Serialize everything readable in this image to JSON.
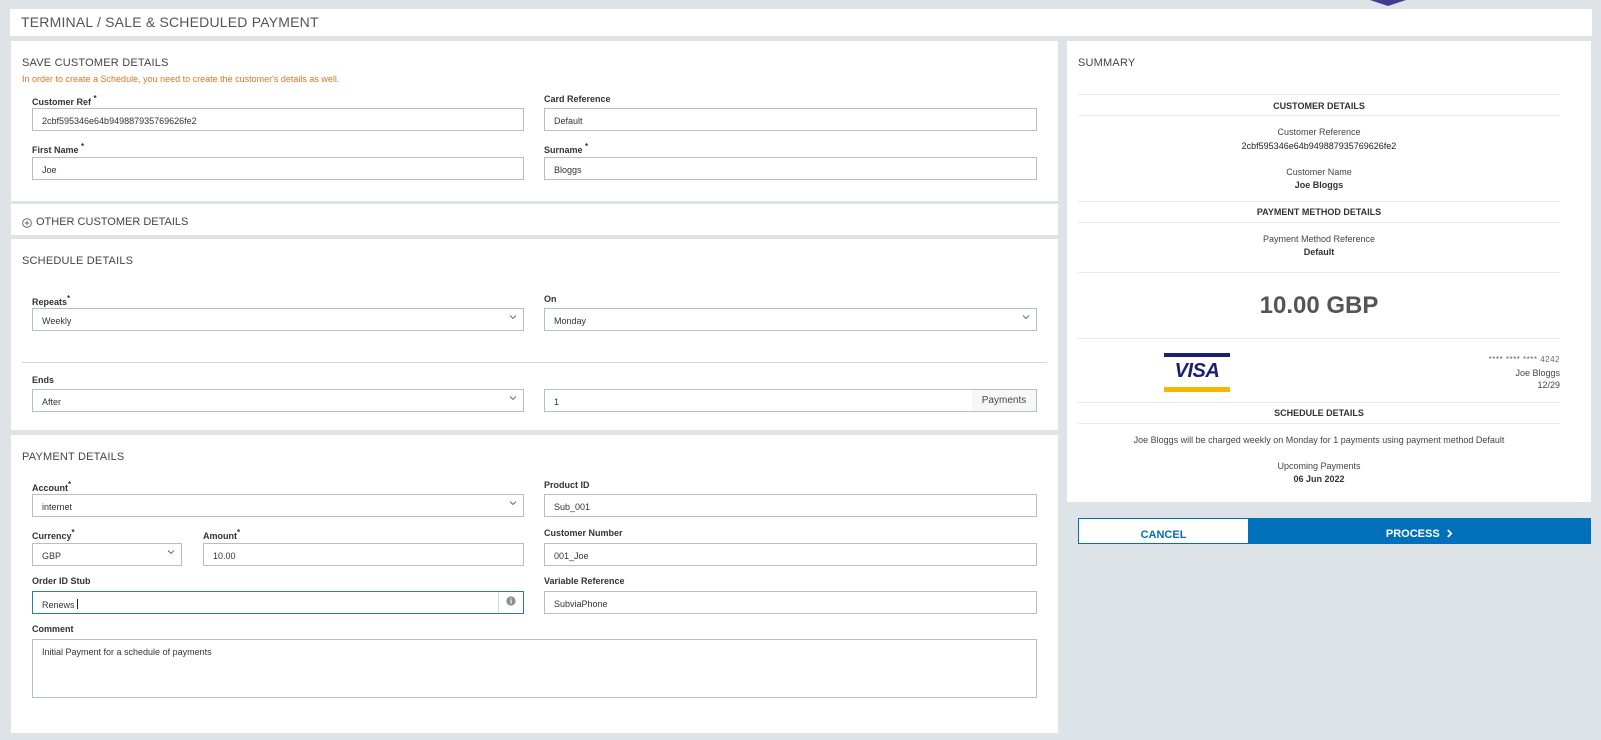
{
  "page": {
    "title": "TERMINAL / SALE & SCHEDULED PAYMENT"
  },
  "customer": {
    "section_title": "SAVE CUSTOMER DETAILS",
    "notice": "In order to create a Schedule, you need to create the customer's details as well.",
    "customer_ref_label": "Customer Ref",
    "customer_ref_value": "2cbf595346e64b949887935769626fe2",
    "card_reference_label": "Card Reference",
    "card_reference_value": "Default",
    "first_name_label": "First Name",
    "first_name_value": "Joe",
    "surname_label": "Surname",
    "surname_value": "Bloggs",
    "required_mark": "*"
  },
  "other_customer": {
    "label": "OTHER CUSTOMER DETAILS"
  },
  "schedule": {
    "section_title": "SCHEDULE DETAILS",
    "repeats_label": "Repeats",
    "repeats_value": "Weekly",
    "on_label": "On",
    "on_value": "Monday",
    "ends_label": "Ends",
    "ends_value": "After",
    "count_value": "1",
    "count_suffix": "Payments"
  },
  "payment": {
    "section_title": "PAYMENT DETAILS",
    "account_label": "Account",
    "account_value": "internet",
    "product_id_label": "Product ID",
    "product_id_value": "Sub_001",
    "currency_label": "Currency",
    "currency_value": "GBP",
    "amount_label": "Amount",
    "amount_value": "10.00",
    "customer_number_label": "Customer Number",
    "customer_number_value": "001_Joe",
    "order_id_stub_label": "Order ID Stub",
    "order_id_stub_value": "Renews",
    "variable_reference_label": "Variable Reference",
    "variable_reference_value": "SubviaPhone",
    "comment_label": "Comment",
    "comment_value": "Initial Payment for a schedule of payments"
  },
  "summary": {
    "title": "SUMMARY",
    "customer_details_heading": "CUSTOMER DETAILS",
    "customer_reference_label": "Customer Reference",
    "customer_reference_value": "2cbf595346e64b949887935769626fe2",
    "customer_name_label": "Customer Name",
    "customer_name_value": "Joe Bloggs",
    "payment_method_heading": "PAYMENT METHOD DETAILS",
    "payment_method_reference_label": "Payment Method Reference",
    "payment_method_reference_value": "Default",
    "amount_total": "10.00 GBP",
    "card_brand": "VISA",
    "card_masked": "**** **** **** 4242",
    "card_holder": "Joe Bloggs",
    "card_expiry": "12/29",
    "schedule_heading": "SCHEDULE DETAILS",
    "schedule_sentence": "Joe Bloggs will be charged weekly on Monday for 1 payments using payment method Default",
    "upcoming_label": "Upcoming Payments",
    "upcoming_date": "06 Jun 2022"
  },
  "actions": {
    "cancel_label": "CANCEL",
    "process_label": "PROCESS"
  },
  "colors": {
    "accent": "#0070ba",
    "notice": "#d9771e",
    "visa_blue": "#1a1f71",
    "visa_gold": "#f7b600"
  }
}
